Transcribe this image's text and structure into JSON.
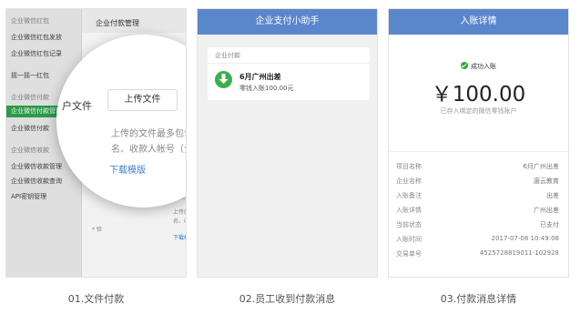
{
  "panels": [
    {
      "caption": "01.文件付款",
      "sidebar": [
        {
          "label": "企业微信红包",
          "group": true
        },
        {
          "label": "企业微信红包发放"
        },
        {
          "label": "企业微信红包记录"
        },
        {
          "label": "摇一摇一红包"
        },
        {
          "label": "企业微信付款",
          "group": true
        },
        {
          "label": "企业微信付款管理",
          "active": true
        },
        {
          "label": "企业微信付款"
        },
        {
          "label": "企业微信收款",
          "group": true
        },
        {
          "label": "企业微信收款管理"
        },
        {
          "label": "企业微信收款查询"
        },
        {
          "label": "API密钥管理"
        }
      ],
      "main_title": "企业付款管理",
      "magnifier": {
        "label": "户文件",
        "upload_button": "上传文件",
        "hint_line1": "上传的文件最多包含",
        "hint_line2": "名、收款人帐号（企",
        "download_link": "下载模版"
      },
      "background_texts": {
        "label_fragment": "件",
        "hint_fragment_1": "上传的文件",
        "hint_fragment_2": "名、收款人",
        "link_fragment": "下载模",
        "required_fragment": "* 验"
      }
    },
    {
      "caption": "02.员工收到付款消息",
      "title": "企业支付小助手",
      "card": {
        "header": "企业付款",
        "title": "6月广州出差",
        "subtitle": "零钱入账100.00元"
      }
    },
    {
      "caption": "03.付款消息详情",
      "title": "入账详情",
      "status": "成功入账",
      "amount": "￥100.00",
      "amount_note": "已存入绑定的微信零钱账户",
      "details": [
        {
          "key": "项目名称",
          "value": "6月广州出差"
        },
        {
          "key": "企业名称",
          "value": "唐云教育"
        },
        {
          "key": "入账备注",
          "value": "出差"
        },
        {
          "key": "入账详情",
          "value": "广州出差"
        },
        {
          "key": "当前状态",
          "value": "已支付"
        },
        {
          "key": "入账时间",
          "value": "2017-07-08  10:49:08"
        },
        {
          "key": "交易单号",
          "value": "4525728819011-102928"
        }
      ]
    }
  ],
  "colors": {
    "title_bar": "#5a87cc",
    "active_sidebar": "#2ea44f",
    "success": "#2eaa3a",
    "link": "#3a7fd0"
  }
}
